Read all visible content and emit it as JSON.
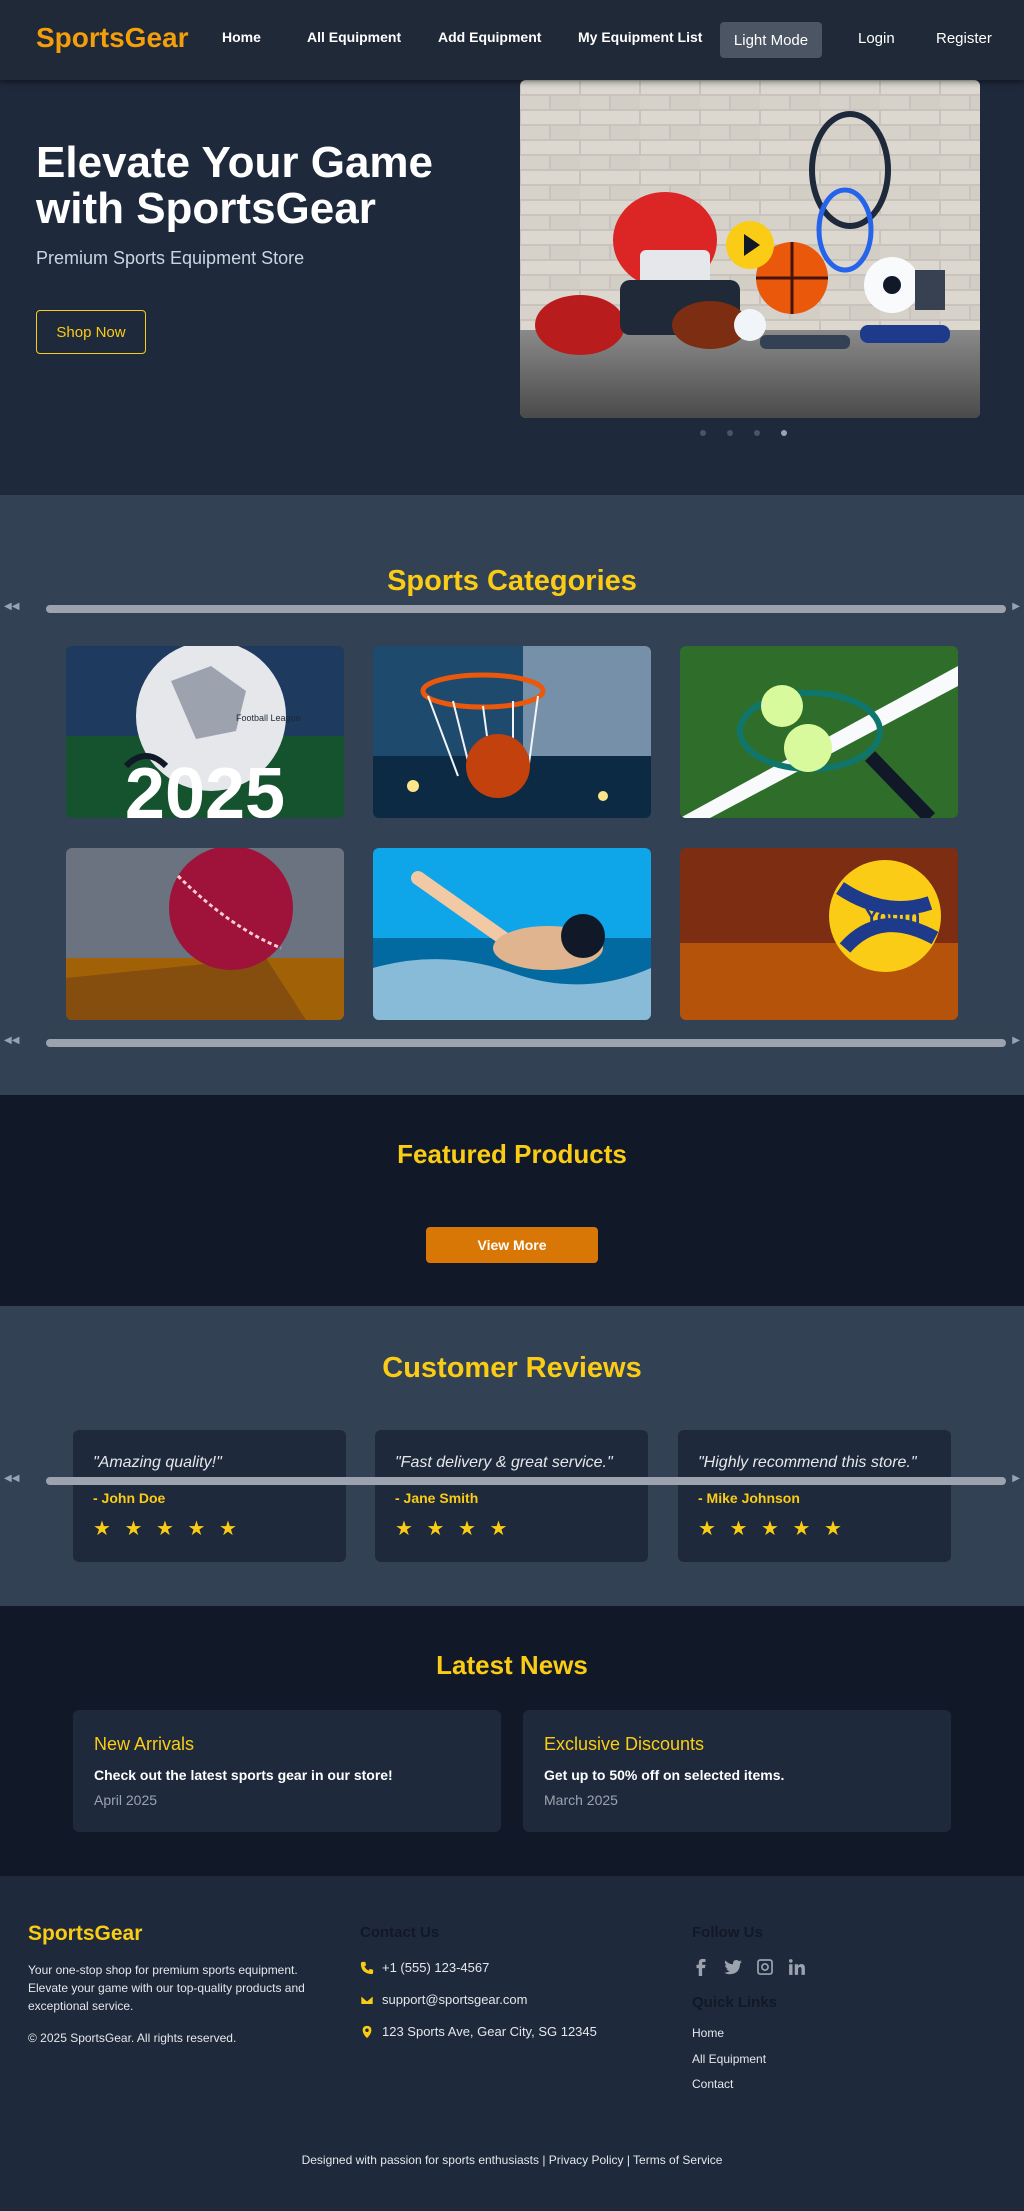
{
  "nav": {
    "logo": "SportsGear",
    "links": [
      "Home",
      "All Equipment",
      "Add Equipment",
      "My Equipment List"
    ],
    "mode_button": "Light Mode",
    "login": "Login",
    "register": "Register"
  },
  "hero": {
    "title": "Elevate Your Game with SportsGear",
    "subtitle": "Premium Sports Equipment Store",
    "cta": "Shop Now",
    "slide_count": 4,
    "active_slide": 4
  },
  "categories": {
    "title": "Sports Categories",
    "items": [
      {
        "name": "soccer-ball-image",
        "overlay_text": "2025",
        "badge": "Football League"
      },
      {
        "name": "basketball-hoop-image"
      },
      {
        "name": "tennis-racket-image"
      },
      {
        "name": "cricket-ball-image"
      },
      {
        "name": "swimmer-image"
      },
      {
        "name": "volleyball-image",
        "badge": "Youth"
      }
    ]
  },
  "featured": {
    "title": "Featured Products",
    "button": "View More"
  },
  "reviews": {
    "title": "Customer Reviews",
    "items": [
      {
        "quote": "\"Amazing quality!\"",
        "name": "- John Doe",
        "stars": "★ ★ ★ ★ ★"
      },
      {
        "quote": "\"Fast delivery & great service.\"",
        "name": "- Jane Smith",
        "stars": "★ ★ ★ ★"
      },
      {
        "quote": "\"Highly recommend this store.\"",
        "name": "- Mike Johnson",
        "stars": "★ ★ ★ ★ ★"
      }
    ]
  },
  "news": {
    "title": "Latest News",
    "items": [
      {
        "title": "New Arrivals",
        "text": "Check out the latest sports gear in our store!",
        "date": "April 2025"
      },
      {
        "title": "Exclusive Discounts",
        "text": "Get up to 50% off on selected items.",
        "date": "March 2025"
      }
    ]
  },
  "footer": {
    "logo": "SportsGear",
    "description": "Your one-stop shop for premium sports equipment. Elevate your game with our top-quality products and exceptional service.",
    "copyright": "© 2025 SportsGear. All rights reserved.",
    "contact_heading": "Contact Us",
    "phone": "+1 (555) 123-4567",
    "email": "support@sportsgear.com",
    "address": "123 Sports Ave, Gear City, SG 12345",
    "follow_heading": "Follow Us",
    "quick_links_heading": "Quick Links",
    "quick_links": [
      "Home",
      "All Equipment",
      "Contact"
    ],
    "bottom_text": "Designed with passion for sports enthusiasts | Privacy Policy | Terms of Service"
  },
  "colors": {
    "accent": "#facc15",
    "brand_orange": "#f59e0b",
    "button_orange": "#d97706",
    "dark_bg": "#111827",
    "panel_bg": "#1e293b",
    "section_bg": "#334155"
  }
}
